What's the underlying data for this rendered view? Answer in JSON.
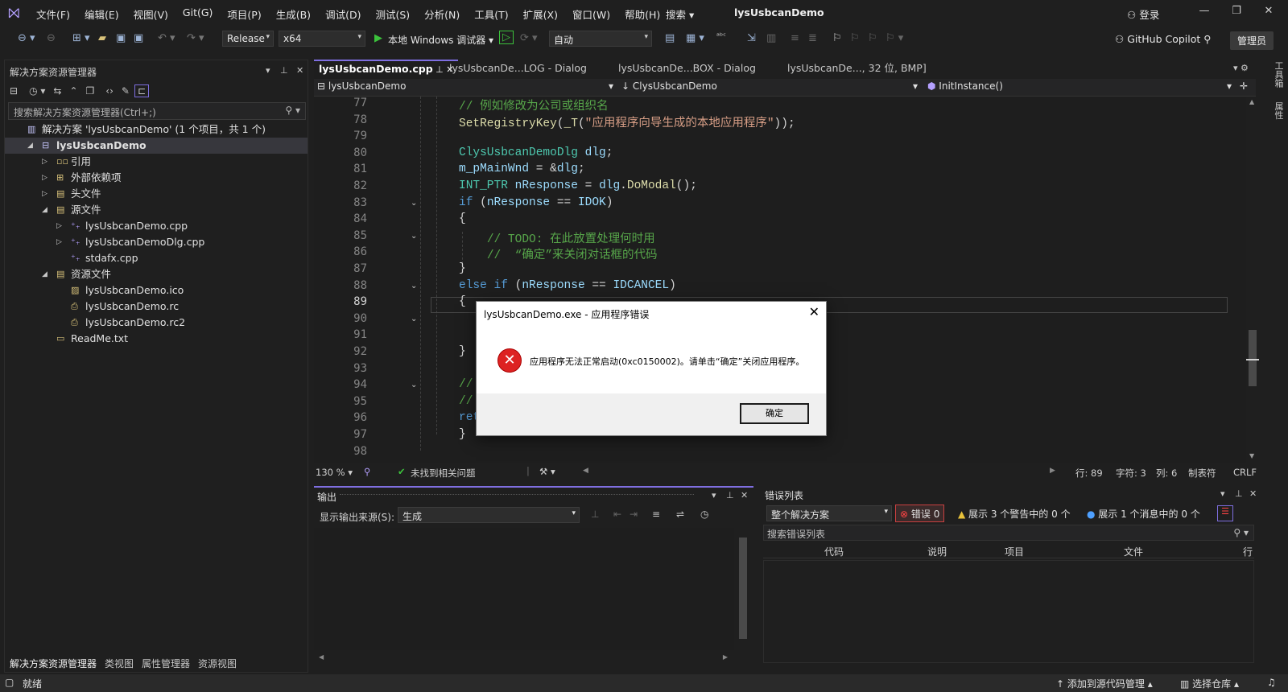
{
  "menu": [
    "文件(F)",
    "编辑(E)",
    "视图(V)",
    "Git(G)",
    "项目(P)",
    "生成(B)",
    "调试(D)",
    "测试(S)",
    "分析(N)",
    "工具(T)",
    "扩展(X)",
    "窗口(W)",
    "帮助(H)"
  ],
  "title": {
    "search": "搜索 ▾",
    "name": "lysUsbcanDemo",
    "login": "登录"
  },
  "toolbar": {
    "config": "Release",
    "platform": "x64",
    "run_target": "本地 Windows 调试器",
    "auto": "自动",
    "copilot": "GitHub Copilot",
    "admin": "管理员"
  },
  "solution_explorer": {
    "title": "解决方案资源管理器",
    "search_placeholder": "搜索解决方案资源管理器(Ctrl+;)",
    "tree": [
      {
        "label": "解决方案 'lysUsbcanDemo' (1 个项目，共 1 个)",
        "indent": 0,
        "arrow": "",
        "icon": "solution-icon"
      },
      {
        "label": "lysUsbcanDemo",
        "indent": 1,
        "arrow": "◢",
        "icon": "project-icon",
        "bold": true
      },
      {
        "label": "引用",
        "indent": 2,
        "arrow": "▷",
        "icon": "references-icon"
      },
      {
        "label": "外部依赖项",
        "indent": 2,
        "arrow": "▷",
        "icon": "external-deps-icon"
      },
      {
        "label": "头文件",
        "indent": 2,
        "arrow": "▷",
        "icon": "folder-icon"
      },
      {
        "label": "源文件",
        "indent": 2,
        "arrow": "◢",
        "icon": "folder-icon"
      },
      {
        "label": "lysUsbcanDemo.cpp",
        "indent": 3,
        "arrow": "▷",
        "icon": "cpp-file-icon"
      },
      {
        "label": "lysUsbcanDemoDlg.cpp",
        "indent": 3,
        "arrow": "▷",
        "icon": "cpp-file-icon"
      },
      {
        "label": "stdafx.cpp",
        "indent": 3,
        "arrow": "",
        "icon": "cpp-file-icon"
      },
      {
        "label": "资源文件",
        "indent": 2,
        "arrow": "◢",
        "icon": "folder-icon"
      },
      {
        "label": "lysUsbcanDemo.ico",
        "indent": 3,
        "arrow": "",
        "icon": "image-file-icon"
      },
      {
        "label": "lysUsbcanDemo.rc",
        "indent": 3,
        "arrow": "",
        "icon": "resource-file-icon"
      },
      {
        "label": "lysUsbcanDemo.rc2",
        "indent": 3,
        "arrow": "",
        "icon": "resource-file-icon"
      },
      {
        "label": "ReadMe.txt",
        "indent": 2,
        "arrow": "",
        "icon": "text-file-icon"
      }
    ],
    "bottom_tabs": [
      "解决方案资源管理器",
      "类视图",
      "属性管理器",
      "资源视图"
    ]
  },
  "editor_tabs": [
    {
      "label": "lysUsbcanDemo.cpp",
      "active": true
    },
    {
      "label": "lysUsbcanDe...LOG - Dialog",
      "active": false
    },
    {
      "label": "lysUsbcanDe...BOX - Dialog",
      "active": false
    },
    {
      "label": "lysUsbcanDe..., 32 位, BMP]",
      "active": false
    }
  ],
  "navbar": {
    "project": "lysUsbcanDemo",
    "class": "ClysUsbcanDemo",
    "member": "InitInstance()"
  },
  "code_lines": [
    {
      "n": "77",
      "html": "<span class='c-com'>// 例如修改为公司或组织名</span>"
    },
    {
      "n": "78",
      "html": "<span class='c-fn'>SetRegistryKey</span>(<span class='c-fn'>_T</span>(<span class='c-str'>\"应用程序向导生成的本地应用程序\"</span>));"
    },
    {
      "n": "79",
      "html": ""
    },
    {
      "n": "80",
      "html": "<span class='c-ty'>ClysUsbcanDemoDlg</span> <span class='c-var'>dlg</span>;"
    },
    {
      "n": "81",
      "html": "<span class='c-var'>m_pMainWnd</span> = &amp;<span class='c-var'>dlg</span>;"
    },
    {
      "n": "82",
      "html": "<span class='c-ty'>INT_PTR</span> <span class='c-var'>nResponse</span> = <span class='c-var'>dlg</span>.<span class='c-fn'>DoModal</span>();"
    },
    {
      "n": "83",
      "html": "<span class='c-kw'>if</span> (<span class='c-var'>nResponse</span> == <span class='c-var'>IDOK</span>)"
    },
    {
      "n": "84",
      "html": "{"
    },
    {
      "n": "85",
      "html": "    <span class='c-com'>// TODO: 在此放置处理何时用</span>"
    },
    {
      "n": "86",
      "html": "    <span class='c-com'>//  “确定”来关闭对话框的代码</span>"
    },
    {
      "n": "87",
      "html": "}"
    },
    {
      "n": "88",
      "html": "<span class='c-kw'>else if</span> (<span class='c-var'>nResponse</span> == <span class='c-var'>IDCANCEL</span>)"
    },
    {
      "n": "89",
      "html": "{"
    },
    {
      "n": "90",
      "html": ""
    },
    {
      "n": "91",
      "html": ""
    },
    {
      "n": "92",
      "html": "}"
    },
    {
      "n": "93",
      "html": ""
    },
    {
      "n": "94",
      "html": "<span class='c-com'>//</span>"
    },
    {
      "n": "95",
      "html": "<span class='c-com'>//</span>"
    },
    {
      "n": "96",
      "html": "<span class='c-kw'>ret</span>"
    },
    {
      "n": "97",
      "html": "}"
    },
    {
      "n": "98",
      "html": ""
    }
  ],
  "editor_status": {
    "zoom": "130 %",
    "issues": "未找到相关问题",
    "line": "行: 89",
    "char": "字符: 3",
    "col": "列: 6",
    "tabs": "制表符",
    "eol": "CRLF"
  },
  "output": {
    "title": "输出",
    "source_label": "显示输出来源(S):",
    "source_value": "生成"
  },
  "error_list": {
    "title": "错误列表",
    "scope": "整个解决方案",
    "errors": "错误 0",
    "warnings": "展示 3 个警告中的 0 个",
    "messages": "展示 1 个消息中的 0 个",
    "search_placeholder": "搜索错误列表",
    "columns": [
      "代码",
      "说明",
      "项目",
      "文件",
      "行"
    ]
  },
  "right_rail": [
    "工具箱",
    "属性"
  ],
  "statusbar": {
    "ready": "就绪",
    "source_control": "添加到源代码管理 ▴",
    "repo": "选择仓库 ▴"
  },
  "dialog": {
    "title": "lysUsbcanDemo.exe - 应用程序错误",
    "message": "应用程序无法正常启动(0xc0150002)。请单击“确定”关闭应用程序。",
    "ok": "确定"
  }
}
